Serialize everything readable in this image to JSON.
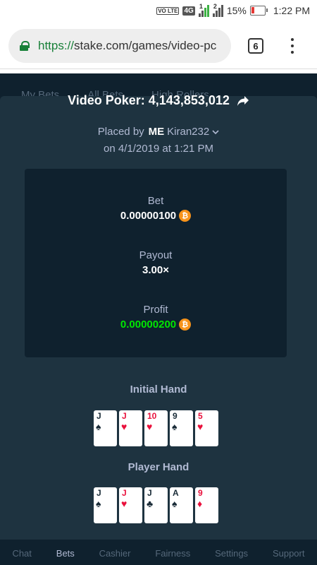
{
  "status_bar": {
    "network": "4G",
    "volte": "VO LTE",
    "sim1": "1",
    "sim2": "2",
    "battery": "15%",
    "time": "1:22 PM"
  },
  "browser": {
    "url_scheme": "https://",
    "url_rest": "stake.com/games/video-pc",
    "tab_count": "6"
  },
  "background_tabs": [
    "My Bets",
    "All Bets",
    "High Rollers"
  ],
  "modal": {
    "title": "Video Poker: 4,143,853,012",
    "placed_by_prefix": "Placed by",
    "placed_by_badge": "ME",
    "placed_by_user": "Kiran232",
    "placed_on": "on 4/1/2019 at 1:21 PM",
    "bet_label": "Bet",
    "bet_value": "0.00000100",
    "payout_label": "Payout",
    "payout_value": "3.00×",
    "profit_label": "Profit",
    "profit_value": "0.00000200",
    "currency_symbol": "₿",
    "initial_hand_label": "Initial Hand",
    "player_hand_label": "Player Hand"
  },
  "initial_hand": [
    {
      "rank": "J",
      "suit": "♠",
      "color": "black"
    },
    {
      "rank": "J",
      "suit": "♥",
      "color": "red"
    },
    {
      "rank": "10",
      "suit": "♥",
      "color": "red"
    },
    {
      "rank": "9",
      "suit": "♠",
      "color": "black"
    },
    {
      "rank": "5",
      "suit": "♥",
      "color": "red"
    }
  ],
  "player_hand": [
    {
      "rank": "J",
      "suit": "♠",
      "color": "black"
    },
    {
      "rank": "J",
      "suit": "♥",
      "color": "red"
    },
    {
      "rank": "J",
      "suit": "♣",
      "color": "black"
    },
    {
      "rank": "A",
      "suit": "♠",
      "color": "black"
    },
    {
      "rank": "9",
      "suit": "♦",
      "color": "red"
    }
  ],
  "bottom_nav": [
    "Chat",
    "Bets",
    "Cashier",
    "Fairness",
    "Settings",
    "Support"
  ],
  "colors": {
    "accent_green": "#00e701",
    "bitcoin": "#f7931a",
    "bg_dark": "#0f212e",
    "modal_bg": "#1e3340"
  }
}
